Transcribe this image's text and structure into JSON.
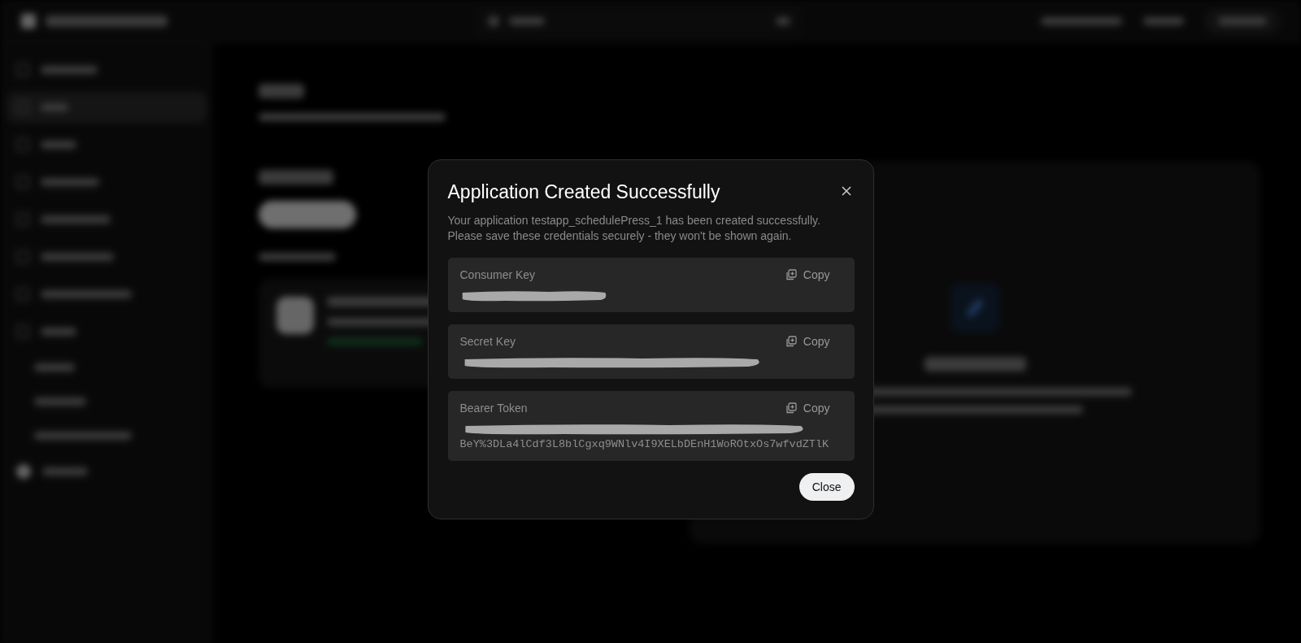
{
  "modal": {
    "title": "Application Created Successfully",
    "message": [
      "Your application testapp_schedulePress_1 has been created successfully.",
      "Please save these credentials securely - they won't be shown again."
    ],
    "credentials": [
      {
        "label": "Consumer Key",
        "copy": "Copy",
        "redacted": true
      },
      {
        "label": "Secret Key",
        "copy": "Copy",
        "redacted": true
      },
      {
        "label": "Bearer Token",
        "copy": "Copy",
        "redacted": true,
        "value": "BeY%3DLa4lCdf3L8blCgxq9WNlv4I9XELbDEnH1WoROtxOs7wfvdZTlK"
      }
    ],
    "close": "Close"
  }
}
